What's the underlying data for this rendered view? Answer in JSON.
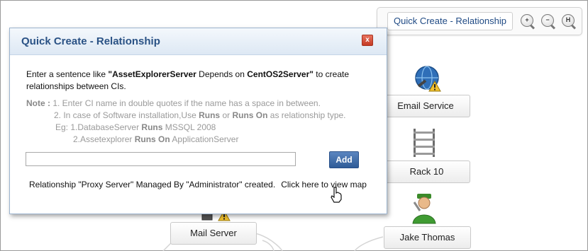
{
  "toolbar": {
    "quick_create_label": "Quick Create - Relationship",
    "zoom_in_symbol": "+",
    "zoom_out_symbol": "−",
    "zoom_fit_symbol": "H"
  },
  "nodes": {
    "email_service": "Email Service",
    "rack_10": "Rack 10",
    "mail_server": "Mail Server",
    "jake_thomas": "Jake Thomas"
  },
  "modal": {
    "title": "Quick Create - Relationship",
    "close_symbol": "x",
    "instruction": {
      "prefix": "Enter a sentence like ",
      "example_ci": "\"AssetExplorerServer",
      "relation": " Depends on ",
      "target_ci": "CentOS2Server\"",
      "suffix": " to create relationships between CIs."
    },
    "notes": {
      "label": "Note :",
      "line1": " 1. Enter CI name in double quotes if the name has a space in between.",
      "line2_a": "2. In case of Software installation,Use ",
      "runs": "Runs",
      "or": " or ",
      "runs_on": "Runs On",
      "line2_b": " as relationship type.",
      "eg_a": "Eg: 1.DatabaseServer ",
      "eg_b": " MSSQL 2008",
      "eg2_a": "2.Assetexplorer ",
      "eg2_b": " ApplicationServer"
    },
    "input_value": "",
    "add_label": "Add",
    "status_message": "Relationship \"Proxy Server\" Managed By \"Administrator\" created.",
    "view_map_link": "Click here to view map"
  },
  "colors": {
    "title_blue": "#2a5285",
    "add_button": "#2f5b97",
    "close_red": "#c43a23",
    "note_gray": "#9a9a9a"
  },
  "icons": [
    "globe-icon",
    "warning-icon",
    "rack-icon",
    "server-icon",
    "user-icon",
    "close-icon",
    "zoom-in-icon",
    "zoom-out-icon",
    "zoom-fit-icon",
    "hand-cursor-icon"
  ]
}
